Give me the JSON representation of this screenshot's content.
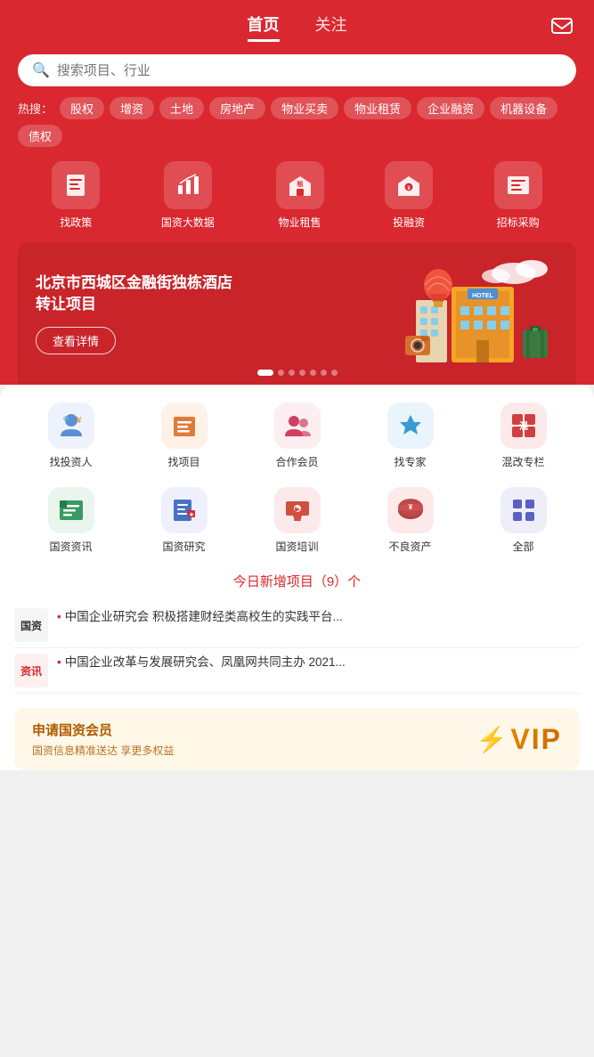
{
  "header": {
    "tabs": [
      {
        "label": "首页",
        "active": true
      },
      {
        "label": "关注",
        "active": false
      }
    ],
    "msg_icon": "message-icon"
  },
  "search": {
    "placeholder": "搜索项目、行业"
  },
  "hot_search": {
    "label": "热搜：",
    "tags": [
      "股权",
      "增资",
      "土地",
      "房地产",
      "物业买卖",
      "物业租赁",
      "企业融资",
      "机器设备",
      "债权"
    ]
  },
  "top_icons": [
    {
      "label": "找政策",
      "icon": "policy"
    },
    {
      "label": "国资大数据",
      "icon": "data"
    },
    {
      "label": "物业租售",
      "icon": "property"
    },
    {
      "label": "投融资",
      "icon": "invest"
    },
    {
      "label": "招标采购",
      "icon": "bid"
    }
  ],
  "banner": {
    "title": "北京市西城区金融街独栋酒店\n转让项目",
    "btn_label": "查看详情",
    "dots": 7,
    "active_dot": 0
  },
  "feature_icons": [
    {
      "label": "找投资人",
      "icon": "investor",
      "color": "#5b8fd4"
    },
    {
      "label": "找项目",
      "icon": "project",
      "color": "#e07c3a"
    },
    {
      "label": "合作会员",
      "icon": "member",
      "color": "#d04060"
    },
    {
      "label": "找专家",
      "icon": "expert",
      "color": "#3a9ad4"
    },
    {
      "label": "混改专栏",
      "icon": "mixed",
      "color": "#d04040"
    }
  ],
  "service_icons": [
    {
      "label": "国资资讯",
      "icon": "news",
      "color": "#3a9a60"
    },
    {
      "label": "国资研究",
      "icon": "research",
      "color": "#4a70c4"
    },
    {
      "label": "国资培训",
      "icon": "training",
      "color": "#d05040"
    },
    {
      "label": "不良资产",
      "icon": "asset",
      "color": "#b04040"
    },
    {
      "label": "全部",
      "icon": "all",
      "color": "#5a60c4"
    }
  ],
  "new_items": {
    "text": "今日新增项目（9）个"
  },
  "news": [
    {
      "badge_line1": "国资",
      "badge_line2": "",
      "badge_color": "#333",
      "bullet": "•",
      "text": "中国企业研究会 积极搭建财经类高校生的实践平台..."
    },
    {
      "badge_line1": "资讯",
      "badge_line2": "",
      "badge_color": "#d9282f",
      "bullet": "•",
      "text": "中国企业改革与发展研究会、凤凰网共同主办 2021..."
    }
  ],
  "vip": {
    "title": "申请国资会员",
    "subtitle": "国资信息精准送达 享更多权益",
    "badge_text": "VIP"
  }
}
